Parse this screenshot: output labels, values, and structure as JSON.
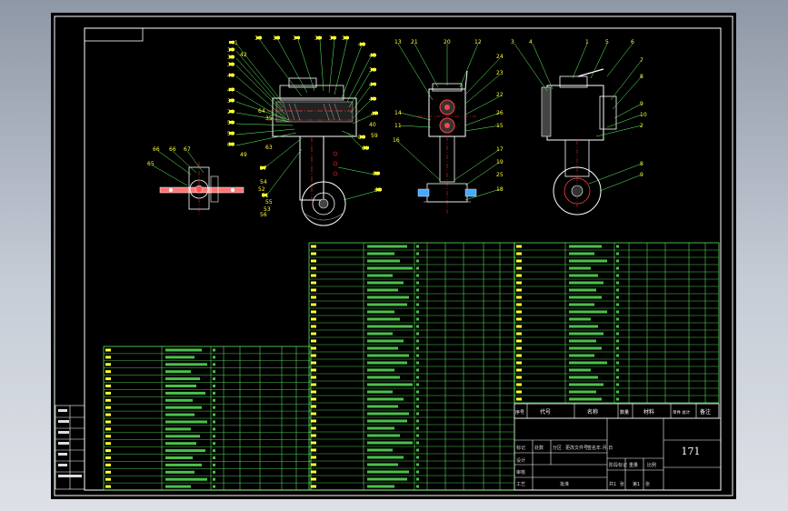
{
  "drawing": {
    "drawing_no": "171",
    "header_cells": [
      "序号",
      "代号",
      "名称",
      "数量",
      "材料",
      "单件 总计",
      "备注"
    ]
  },
  "views": {
    "left_balloons": [
      "41",
      "36",
      "35",
      "34",
      "32",
      "31",
      "30",
      "46",
      "37",
      "33",
      "38",
      "45",
      "39",
      "44",
      "43",
      "48",
      "47",
      "42",
      "37",
      "47",
      "29",
      "59",
      "58",
      "60",
      "64",
      "50",
      "61",
      "40",
      "35",
      "49",
      "63",
      "59",
      "27",
      "62",
      "51",
      "54",
      "52",
      "55",
      "53",
      "56",
      "65"
    ],
    "small_view_balloons": [
      "66",
      "66",
      "67",
      "65"
    ],
    "middle_balloons": [
      "13",
      "21",
      "20",
      "12",
      "24",
      "23",
      "22",
      "14",
      "11",
      "26",
      "15",
      "16",
      "17",
      "19",
      "18",
      "25"
    ],
    "right_balloons": [
      "3",
      "4",
      "1",
      "5",
      "6",
      "7",
      "8",
      "9",
      "10",
      "2",
      "8",
      "9"
    ]
  },
  "title_block": {
    "labels": [
      "标记",
      "处数",
      "分区",
      "更改文件号",
      "签名",
      "年.月.日",
      "设计",
      "审核",
      "工艺",
      "批准",
      "阶段标记",
      "重量",
      "比例",
      "共1",
      "张",
      "第1",
      "张"
    ]
  }
}
